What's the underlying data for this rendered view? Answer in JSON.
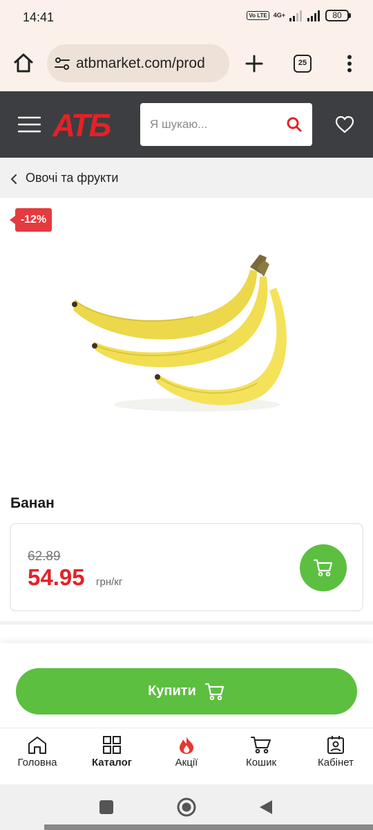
{
  "status_bar": {
    "time": "14:41",
    "network": "4G+",
    "volte": "Vo LTE",
    "battery": "80"
  },
  "browser": {
    "url": "atbmarket.com/prod",
    "tab_count": "25",
    "icons": [
      "home-icon",
      "site-settings-icon",
      "plus-icon",
      "tabs-icon",
      "more-vert-icon"
    ]
  },
  "header": {
    "logo": "АТБ",
    "search_placeholder": "Я шукаю...",
    "accent_color": "#e32227"
  },
  "breadcrumb": {
    "label": "Овочі та фрукти"
  },
  "product": {
    "discount": "-12%",
    "name": "Банан",
    "old_price": "62.89",
    "price": "54.95",
    "unit": "грн/кг",
    "image": "banana-bunch"
  },
  "buy_button": {
    "label": "Купити",
    "color": "#5cbf3f"
  },
  "bottom_nav": {
    "items": [
      {
        "label": "Головна",
        "icon": "home-icon"
      },
      {
        "label": "Каталог",
        "icon": "grid-icon"
      },
      {
        "label": "Акції",
        "icon": "fire-icon"
      },
      {
        "label": "Кошик",
        "icon": "cart-icon"
      },
      {
        "label": "Кабінет",
        "icon": "account-icon"
      }
    ],
    "active": "Каталог"
  }
}
